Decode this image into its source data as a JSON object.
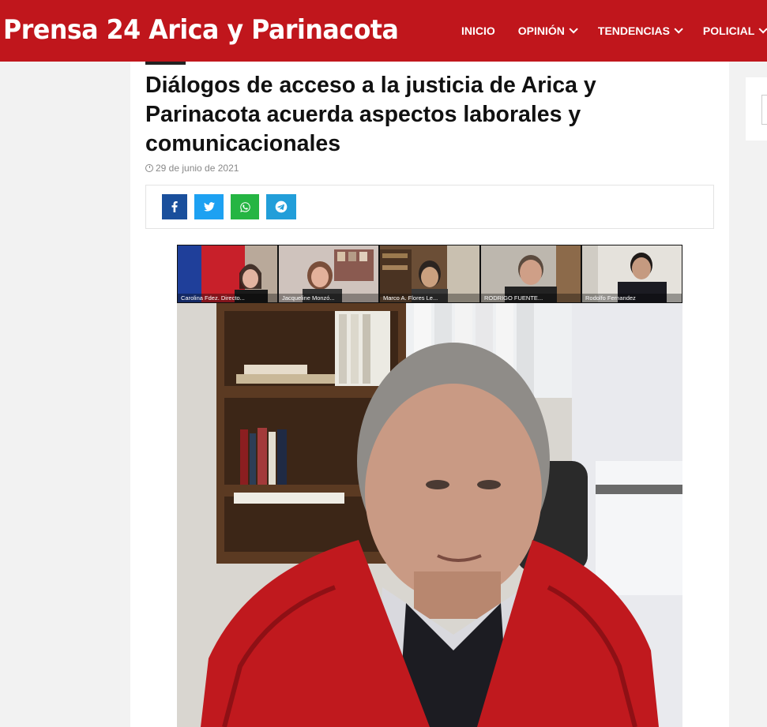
{
  "header": {
    "logo": "Prensa 24 Arica y Parinacota",
    "nav": [
      {
        "label": "INICIO"
      },
      {
        "label": "OPINIÓN"
      },
      {
        "label": "TENDENCIAS"
      },
      {
        "label": "POLICIAL"
      }
    ]
  },
  "article": {
    "title": "Diálogos de acceso a la justicia de Arica y Parinacota acuerda aspectos laborales y comunicacionales",
    "date": "29 de junio de 2021",
    "share": {
      "facebook": "f",
      "twitter": "t",
      "whatsapp": "w",
      "telegram": "tg"
    },
    "photo": {
      "participants": [
        {
          "caption": "Carolina Fdez. Directo..."
        },
        {
          "caption": "Jacqueline Monzó..."
        },
        {
          "caption": "Marco A. Flores Le..."
        },
        {
          "caption": "RODRIGO FUENTE..."
        },
        {
          "caption": "Rodolfo Fernandez"
        }
      ]
    }
  },
  "colors": {
    "brand": "#c0161c",
    "facebook": "#1a4f9c",
    "twitter": "#1da1f2",
    "whatsapp": "#25b543",
    "telegram": "#229ed9"
  }
}
